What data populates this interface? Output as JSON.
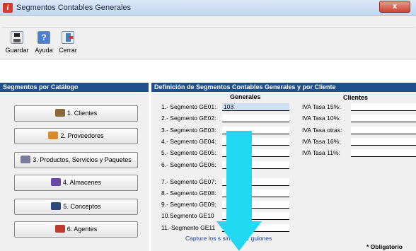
{
  "window": {
    "title": "Segmentos Contables Generales",
    "close_label": "x"
  },
  "toolbar": {
    "save_label": "Guardar",
    "help_label": "Ayuda",
    "close_label": "Cerrar"
  },
  "panels": {
    "left_title": "Segmentos por Catálogo",
    "right_title": "Definición de Segmentos Contables Generales y por Cliente"
  },
  "catalog_buttons": [
    {
      "label": "1. Clientes",
      "icon": "people-icon"
    },
    {
      "label": "2. Proveedores",
      "icon": "truck-icon"
    },
    {
      "label": "3. Productos, Servicios y Paquetes",
      "icon": "boxes-icon"
    },
    {
      "label": "4. Almacenes",
      "icon": "warehouse-icon"
    },
    {
      "label": "5. Conceptos",
      "icon": "book-icon"
    },
    {
      "label": "6. Agentes",
      "icon": "agent-icon"
    }
  ],
  "generales": {
    "header": "Generales",
    "segments": [
      {
        "label": "1.- Segmento GE01:",
        "value": "103"
      },
      {
        "label": "2.- Segmento GE02:",
        "value": ""
      },
      {
        "label": "3.- Segmento GE03:",
        "value": ""
      },
      {
        "label": "4.- Segmento GE04:",
        "value": ""
      },
      {
        "label": "5.- Segmento GE05:",
        "value": ""
      },
      {
        "label": "6.- Segmento GE06:",
        "value": ""
      },
      {
        "label": "7.- Segmento GE07:",
        "value": ""
      },
      {
        "label": "8.- Segmento GE08:",
        "value": ""
      },
      {
        "label": "9.- Segmento GE09:",
        "value": ""
      },
      {
        "label": "10.Segmento GE10",
        "value": ""
      },
      {
        "label": "11.-Segmento GE11",
        "value": ""
      }
    ]
  },
  "clientes": {
    "header": "Clientes",
    "fields": [
      {
        "label": "IVA Tasa 15%:",
        "value": ""
      },
      {
        "label": "IVA Tasa 10%:",
        "value": ""
      },
      {
        "label": "IVA Tasa otras:",
        "value": ""
      },
      {
        "label": "IVA Tasa 16%:",
        "value": ""
      },
      {
        "label": "IVA Tasa 11%:",
        "value": ""
      }
    ]
  },
  "hint_text": "Capture los                 s sin utilizar guiones",
  "mandatory_text": "* Obligatorio",
  "colors": {
    "header_bg": "#1f4f8c",
    "arrow": "#22d8f0",
    "hint": "#1a3fa8"
  }
}
